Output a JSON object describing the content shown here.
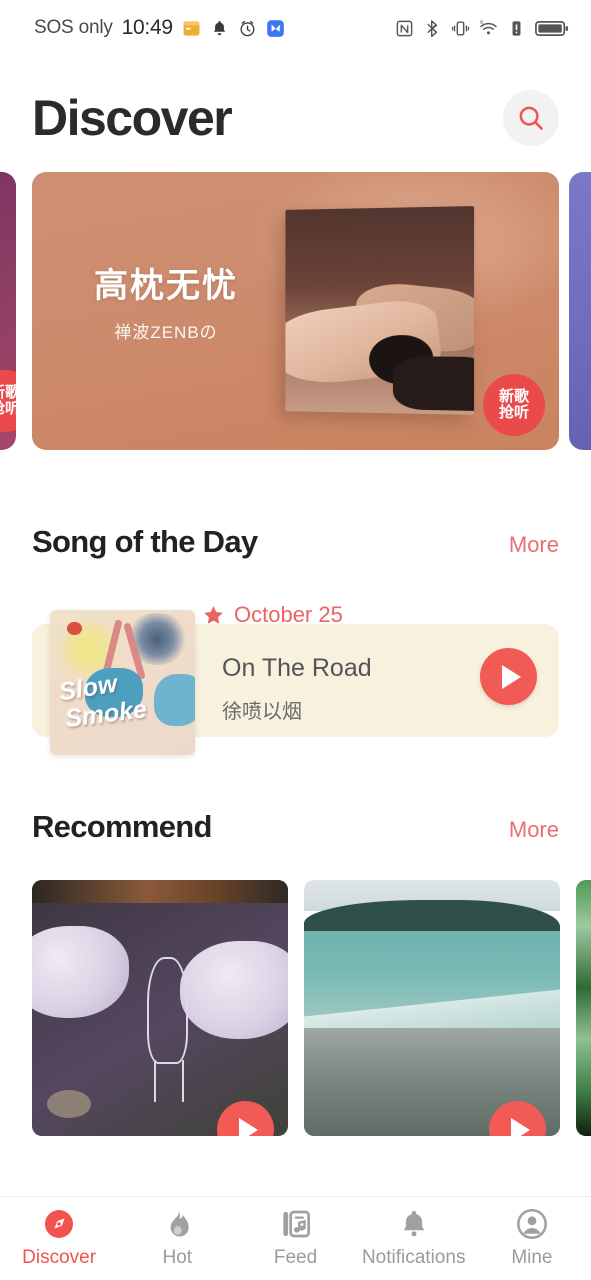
{
  "status_bar": {
    "carrier": "SOS only",
    "time": "10:49",
    "left_icons": [
      "calendar-icon",
      "bell-icon",
      "alarm-clock-icon",
      "app-icon"
    ],
    "right_icons": [
      "nfc-icon",
      "bluetooth-icon",
      "vibrate-icon",
      "wifi-6-icon",
      "battery-alert-icon",
      "battery-icon"
    ],
    "wifi_label": "6"
  },
  "header": {
    "title": "Discover",
    "search_icon": "search-icon"
  },
  "banner": {
    "title": "高枕无忧",
    "artist": "禅波ZENBの",
    "badge_line1": "新歌",
    "badge_line2": "抢听",
    "peek_left_badge_line1": "新歌",
    "peek_left_badge_line2": "抢听"
  },
  "song_of_the_day": {
    "section_title": "Song of the Day",
    "more_label": "More",
    "star_icon": "star-icon",
    "date": "October 25",
    "song": "On The Road",
    "artist": "徐喷以烟",
    "cover_word1": "Slow",
    "cover_word2": "Smoke",
    "play_icon": "play-icon"
  },
  "recommend": {
    "section_title": "Recommend",
    "more_label": "More",
    "play_icon": "play-icon"
  },
  "bottom_nav": {
    "items": [
      {
        "label": "Discover",
        "icon": "compass-icon",
        "active": true
      },
      {
        "label": "Hot",
        "icon": "flame-icon",
        "active": false
      },
      {
        "label": "Feed",
        "icon": "music-feed-icon",
        "active": false
      },
      {
        "label": "Notifications",
        "icon": "bell-icon",
        "active": false
      },
      {
        "label": "Mine",
        "icon": "person-icon",
        "active": false
      }
    ]
  },
  "colors": {
    "accent_red": "#f2534f",
    "more_link": "#e8706e",
    "banner_bg": "#cd8b6d",
    "sotd_card_bg": "#f7f1dd",
    "badge_red": "#ea4a4a",
    "title_dark": "#2b2b2b",
    "nav_inactive": "#9b9b9b"
  }
}
